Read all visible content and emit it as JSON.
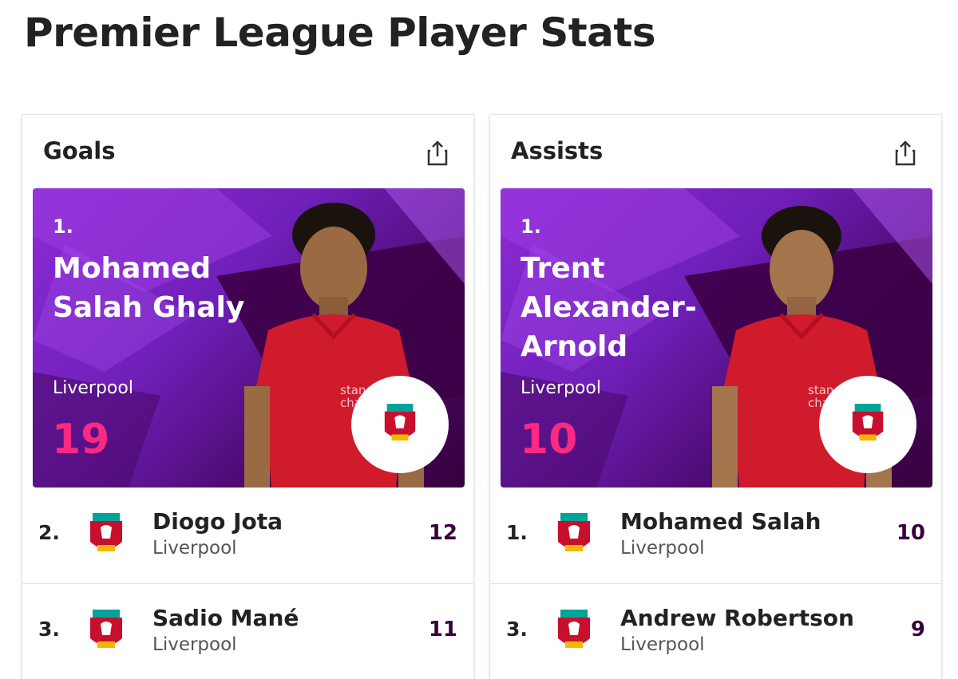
{
  "page": {
    "title": "Premier League Player Stats"
  },
  "cards": [
    {
      "title": "Goals",
      "leader": {
        "rank": "1.",
        "name": "Mohamed Salah Ghaly",
        "club": "Liverpool",
        "value": "19"
      },
      "rows": [
        {
          "rank": "2.",
          "name": "Diogo Jota",
          "club": "Liverpool",
          "value": "12"
        },
        {
          "rank": "3.",
          "name": "Sadio Mané",
          "club": "Liverpool",
          "value": "11"
        }
      ]
    },
    {
      "title": "Assists",
      "leader": {
        "rank": "1.",
        "name": "Trent Alexander-Arnold",
        "club": "Liverpool",
        "value": "10"
      },
      "rows": [
        {
          "rank": "1.",
          "name": "Mohamed Salah",
          "club": "Liverpool",
          "value": "10"
        },
        {
          "rank": "3.",
          "name": "Andrew Robertson",
          "club": "Liverpool",
          "value": "9"
        }
      ]
    }
  ],
  "icons": {
    "share": "share-icon",
    "crest": "liverpool-crest-icon",
    "player": "player-photo"
  },
  "colors": {
    "accent": "#ff2882",
    "brand": "#37003c",
    "hero_purple": "#6f1fb8",
    "kit_red": "#d01b2c"
  }
}
